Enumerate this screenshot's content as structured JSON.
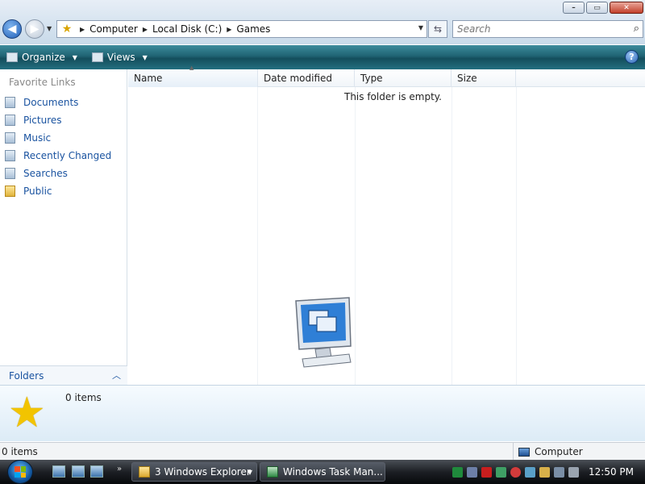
{
  "window": {
    "controls": {
      "minimize": "–",
      "maximize": "▭",
      "close": "✕"
    }
  },
  "address": {
    "breadcrumb": [
      "Computer",
      "Local Disk (C:)",
      "Games"
    ],
    "search_placeholder": "Search"
  },
  "toolbar": {
    "organize_label": "Organize",
    "views_label": "Views",
    "help_label": "?"
  },
  "nav": {
    "favorite_links_title": "Favorite Links",
    "items": [
      {
        "label": "Documents",
        "icon": "documents-icon"
      },
      {
        "label": "Pictures",
        "icon": "pictures-icon"
      },
      {
        "label": "Music",
        "icon": "music-icon"
      },
      {
        "label": "Recently Changed",
        "icon": "recently-changed-icon"
      },
      {
        "label": "Searches",
        "icon": "searches-icon"
      },
      {
        "label": "Public",
        "icon": "folder-icon"
      }
    ],
    "folders_label": "Folders"
  },
  "columns": [
    "Name",
    "Date modified",
    "Type",
    "Size"
  ],
  "content": {
    "empty_message": "This folder is empty."
  },
  "details": {
    "item_count": "0 items"
  },
  "status": {
    "left": "0 items",
    "right": "Computer"
  },
  "taskbar": {
    "tasks": [
      {
        "label": "3 Windows Explorer"
      },
      {
        "label": "Windows Task Man..."
      }
    ],
    "clock": "12:50 PM"
  }
}
